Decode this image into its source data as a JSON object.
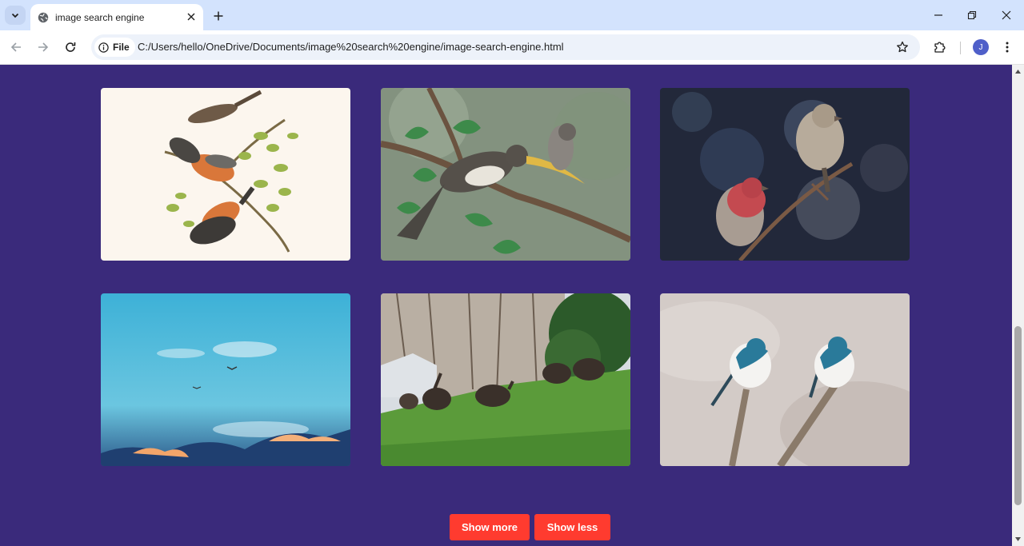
{
  "browser": {
    "tab_title": "image search engine",
    "site_chip_label": "File",
    "url": "C:/Users/hello/OneDrive/Documents/image%20search%20engine/image-search-engine.html",
    "profile_initial": "J"
  },
  "gallery": {
    "images": [
      {
        "subject": "illustrated birds on a branch"
      },
      {
        "subject": "hornbill painting"
      },
      {
        "subject": "finches on a branch"
      },
      {
        "subject": "birds flying in blue sky"
      },
      {
        "subject": "wild turkeys on grass"
      },
      {
        "subject": "two swallows on branches"
      }
    ]
  },
  "buttons": {
    "show_more": "Show more",
    "show_less": "Show less"
  },
  "colors": {
    "page_background": "#3a2a7b",
    "button": "#ff3b2f",
    "tabstrip": "#d3e3fd"
  }
}
